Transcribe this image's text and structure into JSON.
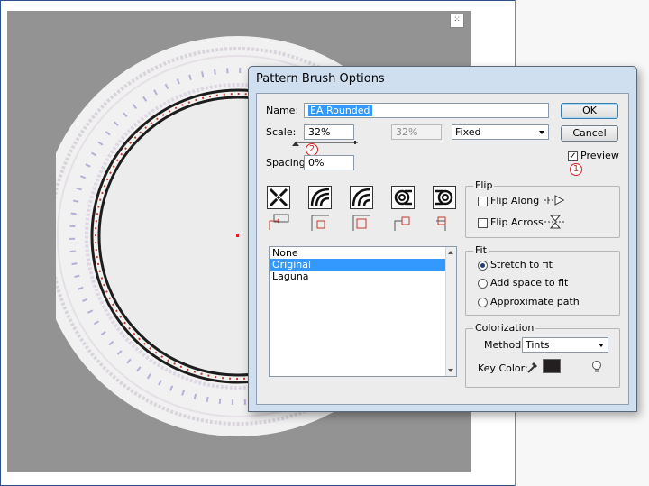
{
  "dialog": {
    "title": "Pattern Brush Options",
    "name_label": "Name:",
    "name_value": "EA Rounded",
    "scale_label": "Scale:",
    "scale_value": "32%",
    "scale_max_value": "32%",
    "scale_method": "Fixed",
    "spacing_label": "Spacing:",
    "spacing_value": "0%",
    "ok_label": "OK",
    "cancel_label": "Cancel",
    "preview_label": "Preview",
    "preview_checked": true,
    "callout_1": "1",
    "callout_2": "2",
    "tiles": [
      "side-tile-icon",
      "outer-corner-tile-icon",
      "inner-corner-tile-icon",
      "start-tile-icon",
      "end-tile-icon"
    ],
    "tile_list": {
      "items": [
        "None",
        "Original",
        "Laguna"
      ],
      "selected_index": 1
    },
    "flip": {
      "title": "Flip",
      "along_label": "Flip Along",
      "along_checked": false,
      "across_label": "Flip Across",
      "across_checked": false
    },
    "fit": {
      "title": "Fit",
      "options": [
        "Stretch to fit",
        "Add space to fit",
        "Approximate path"
      ],
      "selected_index": 0
    },
    "colorization": {
      "title": "Colorization",
      "method_label": "Method:",
      "method_value": "Tints",
      "key_color_label": "Key Color:",
      "key_color": "#231f20"
    }
  },
  "colors": {
    "accent": "#3399ff",
    "callout": "#d42020",
    "canvas_bg": "#939393"
  }
}
